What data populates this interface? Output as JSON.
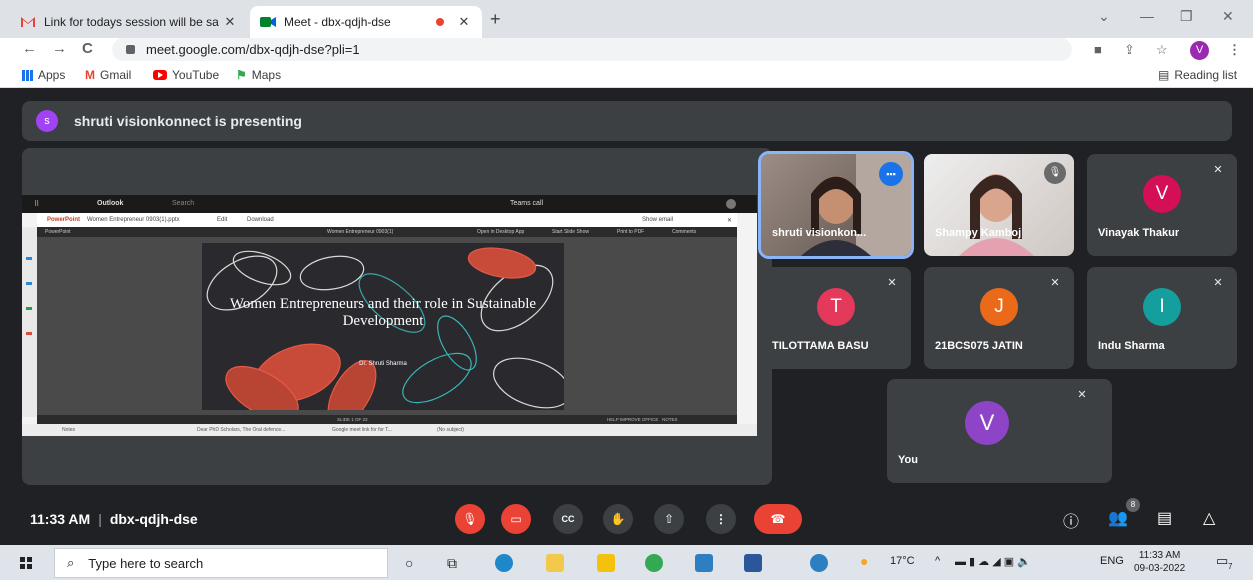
{
  "browser": {
    "tabs": [
      {
        "title": "Link for todays session will be sa",
        "active": false
      },
      {
        "title": "Meet - dbx-qdjh-dse",
        "active": true
      }
    ],
    "new_tab_glyph": "+",
    "url": "meet.google.com/dbx-qdjh-dse?pli=1",
    "profile_initial": "V",
    "bookmarks": [
      "Apps",
      "Gmail",
      "YouTube",
      "Maps"
    ],
    "reading_list": "Reading list"
  },
  "meet": {
    "presenting_banner": "shruti visionkonnect is presenting",
    "presenter_initial": "s",
    "presentation": {
      "outlook_label": "Outlook",
      "search_placeholder": "Search",
      "teams_call": "Teams call",
      "app_name": "PowerPoint",
      "file_name": "Women Entrepreneur 0903(1).pptx",
      "edit": "Edit",
      "download": "Download",
      "show_email": "Show email",
      "ribbon_app": "PowerPoint",
      "doc_title": "Women Entrepreneur 0903(1)",
      "open_desktop": "Open in Desktop App",
      "start_slide_show": "Start Slide Show",
      "print_pdf": "Print to PDF",
      "comments": "Comments",
      "slide_title": "Women Entrepreneurs and their role in Sustainable Development",
      "slide_author": "Dr. Shruti Sharma",
      "slide_counter": "SLIDE 1 OF 23",
      "help_improve": "HELP IMPROVE OFFICE",
      "notes": "NOTES",
      "email_snippet": "Dear PhD Scholars, The Oral defence...",
      "email_subject": "Google meet link for for T...",
      "email_subject2": "(No subject)",
      "notes_folder": "Notes"
    },
    "participants": [
      {
        "name": "shruti visionkon...",
        "type": "video",
        "speaking": true
      },
      {
        "name": "Shampy Kamboj",
        "type": "video",
        "muted": true
      },
      {
        "name": "Vinayak Thakur",
        "initial": "V",
        "color": "#d50f55",
        "muted": true
      },
      {
        "name": "TILOTTAMA BASU",
        "initial": "T",
        "color": "#e5395c",
        "muted": true
      },
      {
        "name": "21BCS075 JATIN",
        "initial": "J",
        "color": "#ea6a1a",
        "muted": true
      },
      {
        "name": "Indu Sharma",
        "initial": "I",
        "color": "#159e9e",
        "muted": true
      },
      {
        "name": "You",
        "initial": "V",
        "color": "#8e44c7",
        "muted": true
      }
    ],
    "time": "11:33 AM",
    "meeting_code": "dbx-qdjh-dse",
    "people_count": "8"
  },
  "taskbar": {
    "search_placeholder": "Type here to search",
    "weather": "17°C",
    "language": "ENG",
    "time": "11:33 AM",
    "date": "09-03-2022",
    "notification_count": "7"
  },
  "icons": {
    "mic_off": "mic-off-icon",
    "camera_off": "camera-off-icon",
    "captions": "captions-icon",
    "hand": "raise-hand-icon",
    "present": "present-icon",
    "more": "more-options-icon",
    "end_call": "end-call-icon"
  }
}
